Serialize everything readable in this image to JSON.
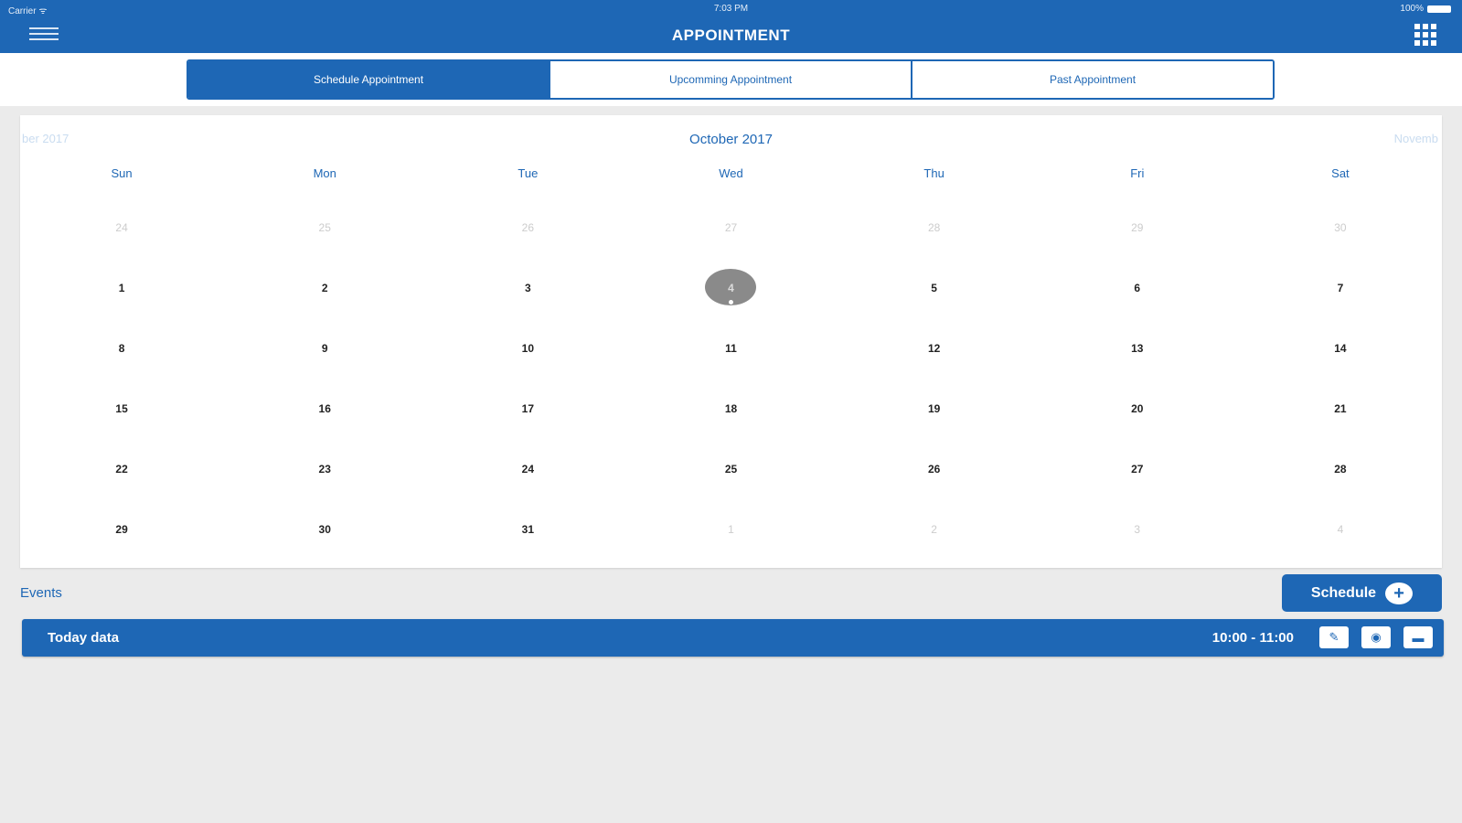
{
  "status_bar": {
    "carrier": "Carrier ᯤ",
    "time": "7:03 PM",
    "battery": "100%"
  },
  "header": {
    "title": "APPOINTMENT",
    "menu_icon": "hamburger-menu-icon",
    "apps_icon": "grid-apps-icon"
  },
  "tabs": [
    {
      "label": "Schedule Appointment",
      "active": true
    },
    {
      "label": "Upcomming Appointment",
      "active": false
    },
    {
      "label": "Past Appointment",
      "active": false
    }
  ],
  "calendar": {
    "month_title": "October 2017",
    "prev_label": "ber 2017",
    "next_label": "Novemb",
    "weekdays": [
      "Sun",
      "Mon",
      "Tue",
      "Wed",
      "Thu",
      "Fri",
      "Sat"
    ],
    "days": [
      {
        "label": "24",
        "muted": true
      },
      {
        "label": "25",
        "muted": true
      },
      {
        "label": "26",
        "muted": true
      },
      {
        "label": "27",
        "muted": true
      },
      {
        "label": "28",
        "muted": true
      },
      {
        "label": "29",
        "muted": true
      },
      {
        "label": "30",
        "muted": true
      },
      {
        "label": "1"
      },
      {
        "label": "2"
      },
      {
        "label": "3"
      },
      {
        "label": "4",
        "today": true
      },
      {
        "label": "5"
      },
      {
        "label": "6"
      },
      {
        "label": "7"
      },
      {
        "label": "8"
      },
      {
        "label": "9"
      },
      {
        "label": "10"
      },
      {
        "label": "11"
      },
      {
        "label": "12"
      },
      {
        "label": "13"
      },
      {
        "label": "14"
      },
      {
        "label": "15"
      },
      {
        "label": "16"
      },
      {
        "label": "17"
      },
      {
        "label": "18"
      },
      {
        "label": "19"
      },
      {
        "label": "20"
      },
      {
        "label": "21"
      },
      {
        "label": "22"
      },
      {
        "label": "23"
      },
      {
        "label": "24"
      },
      {
        "label": "25"
      },
      {
        "label": "26"
      },
      {
        "label": "27"
      },
      {
        "label": "28"
      },
      {
        "label": "29"
      },
      {
        "label": "30"
      },
      {
        "label": "31"
      },
      {
        "label": "1",
        "muted": true
      },
      {
        "label": "2",
        "muted": true
      },
      {
        "label": "3",
        "muted": true
      },
      {
        "label": "4",
        "muted": true
      }
    ]
  },
  "events": {
    "label": "Events",
    "schedule_button": "Schedule",
    "items": [
      {
        "title": "Today data",
        "time": "10:00 - 11:00",
        "actions": [
          "edit-icon",
          "view-icon",
          "delete-icon"
        ]
      }
    ]
  },
  "colors": {
    "primary": "#1e67b5",
    "background": "#ebebeb",
    "today_circle": "#8a8a8a"
  }
}
